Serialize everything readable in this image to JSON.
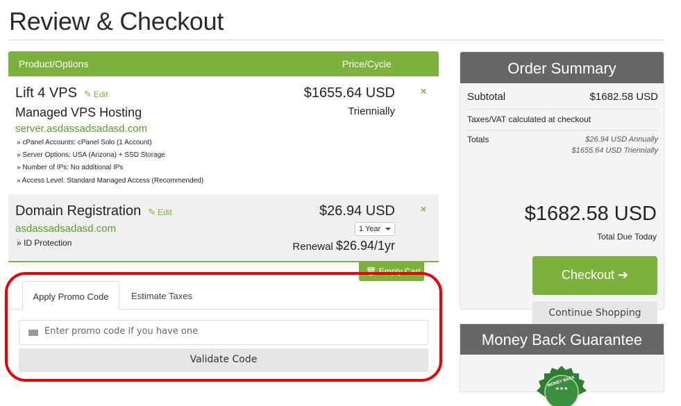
{
  "page": {
    "title": "Review & Checkout"
  },
  "cart": {
    "header": {
      "product": "Product/Options",
      "price": "Price/Cycle"
    },
    "items": [
      {
        "name": "Lift 4 VPS",
        "edit": "Edit",
        "group": "Managed VPS Hosting",
        "domain": "server.asdassadsadasd.com",
        "options": [
          "» cPanel Accounts: cPanel Solo (1 Account)",
          "» Server Options: USA (Arizona) + SSD Storage",
          "» Number of IPs: No additional IPs",
          "» Access Level: Standard Managed Access (Recommended)"
        ],
        "price": "$1655.64 USD",
        "cycle": "Triennially",
        "remove": "×"
      },
      {
        "name": "Domain Registration",
        "edit": "Edit",
        "domain": "asdassadsadasd.com",
        "options": [
          "» ID Protection"
        ],
        "price": "$26.94 USD",
        "period": "1 Year",
        "renewal_label": "Renewal",
        "renewal_amount": "$26.94/1yr",
        "remove": "×"
      }
    ],
    "empty_cart": "Empty Cart"
  },
  "promo": {
    "tabs": [
      "Apply Promo Code",
      "Estimate Taxes"
    ],
    "placeholder": "Enter promo code if you have one",
    "validate": "Validate Code"
  },
  "summary": {
    "title": "Order Summary",
    "subtotal_label": "Subtotal",
    "subtotal": "$1682.58 USD",
    "tax_note": "Taxes/VAT calculated at checkout",
    "totals_label": "Totals",
    "totals_annual": "$26.94 USD Annually",
    "totals_triennial": "$1655.64 USD Triennially",
    "total_due": "$1682.58 USD",
    "total_due_label": "Total Due Today",
    "checkout": "Checkout",
    "checkout_arrow": "➔",
    "continue": "Continue Shopping"
  },
  "guarantee": {
    "title": "Money Back Guarantee",
    "seal_text": "MONEY BACK",
    "seal_stars": "★★★"
  },
  "colors": {
    "accent": "#7bb13c",
    "header_dark": "#666666",
    "annotation": "#e00000"
  }
}
